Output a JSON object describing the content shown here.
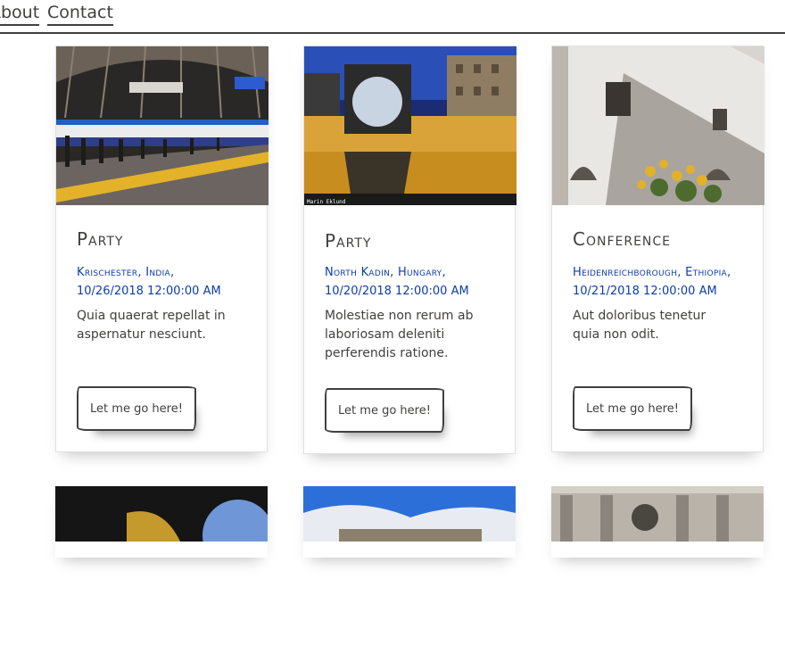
{
  "nav": {
    "about": "About",
    "contact": "Contact"
  },
  "cards": [
    {
      "title": "Party",
      "place": "Krischester, India,",
      "date": "10/26/2018 12:00:00 AM",
      "description": "Quia quaerat repellat in aspernatur nesciunt.",
      "button": "Let me go here!",
      "photo_credit": ""
    },
    {
      "title": "Party",
      "place": "North Kadin, Hungary,",
      "date": "10/20/2018 12:00:00 AM",
      "description": "Molestiae non rerum ab laboriosam deleniti perferendis ratione.",
      "button": "Let me go here!",
      "photo_credit": "Marin Eklund"
    },
    {
      "title": "Conference",
      "place": "Heidenreichborough, Ethiopia,",
      "date": "10/21/2018 12:00:00 AM",
      "description": "Aut doloribus tenetur quia non odit.",
      "button": "Let me go here!",
      "photo_credit": ""
    }
  ],
  "colors": {
    "ink": "#41403e",
    "link_blue": "#0b3ea8",
    "border": "#e0e0e0"
  }
}
